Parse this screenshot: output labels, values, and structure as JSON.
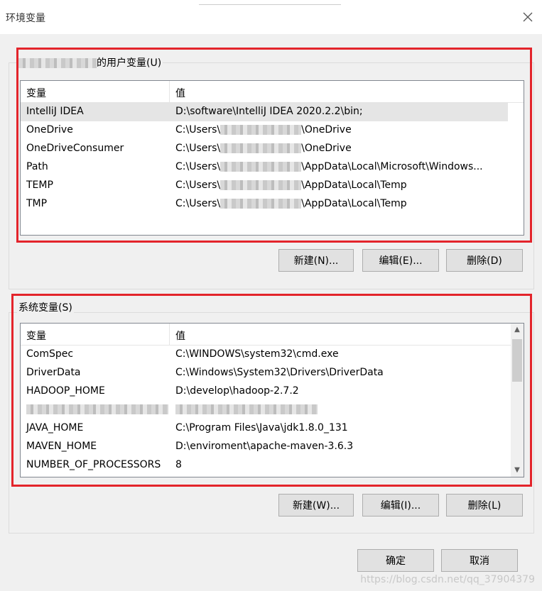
{
  "window": {
    "title": "环境变量",
    "close_icon": "close-icon"
  },
  "user_vars": {
    "label_suffix": "的用户变量(U)",
    "header": {
      "name": "变量",
      "value": "值"
    },
    "rows": [
      {
        "name": "IntelliJ IDEA",
        "value": "D:\\software\\IntelliJ IDEA 2020.2.2\\bin;"
      },
      {
        "name": "OneDrive",
        "prefix": "C:\\Users\\",
        "suffix": "\\OneDrive"
      },
      {
        "name": "OneDriveConsumer",
        "prefix": "C:\\Users\\",
        "suffix": "\\OneDrive"
      },
      {
        "name": "Path",
        "prefix": "C:\\Users\\",
        "suffix": "\\AppData\\Local\\Microsoft\\Windows..."
      },
      {
        "name": "TEMP",
        "prefix": "C:\\Users\\",
        "suffix": "\\AppData\\Local\\Temp"
      },
      {
        "name": "TMP",
        "prefix": "C:\\Users\\",
        "suffix": "\\AppData\\Local\\Temp"
      }
    ],
    "buttons": {
      "new": "新建(N)...",
      "edit": "编辑(E)...",
      "delete": "删除(D)"
    }
  },
  "system_vars": {
    "label": "系统变量(S)",
    "header": {
      "name": "变量",
      "value": "值"
    },
    "rows": [
      {
        "name": "ComSpec",
        "value": "C:\\WINDOWS\\system32\\cmd.exe"
      },
      {
        "name": "DriverData",
        "value": "C:\\Windows\\System32\\Drivers\\DriverData"
      },
      {
        "name": "HADOOP_HOME",
        "value": "D:\\develop\\hadoop-2.7.2"
      },
      {
        "name": "",
        "value": ""
      },
      {
        "name": "JAVA_HOME",
        "value": "C:\\Program Files\\Java\\jdk1.8.0_131"
      },
      {
        "name": "MAVEN_HOME",
        "value": "D:\\enviroment\\apache-maven-3.6.3"
      },
      {
        "name": "NUMBER_OF_PROCESSORS",
        "value": "8"
      }
    ],
    "buttons": {
      "new": "新建(W)...",
      "edit": "编辑(I)...",
      "delete": "删除(L)"
    }
  },
  "footer": {
    "ok": "确定",
    "cancel": "取消"
  },
  "watermark": "https://blog.csdn.net/qq_37904379",
  "colors": {
    "highlight": "#e3242b",
    "selection": "#e5e5e5"
  }
}
